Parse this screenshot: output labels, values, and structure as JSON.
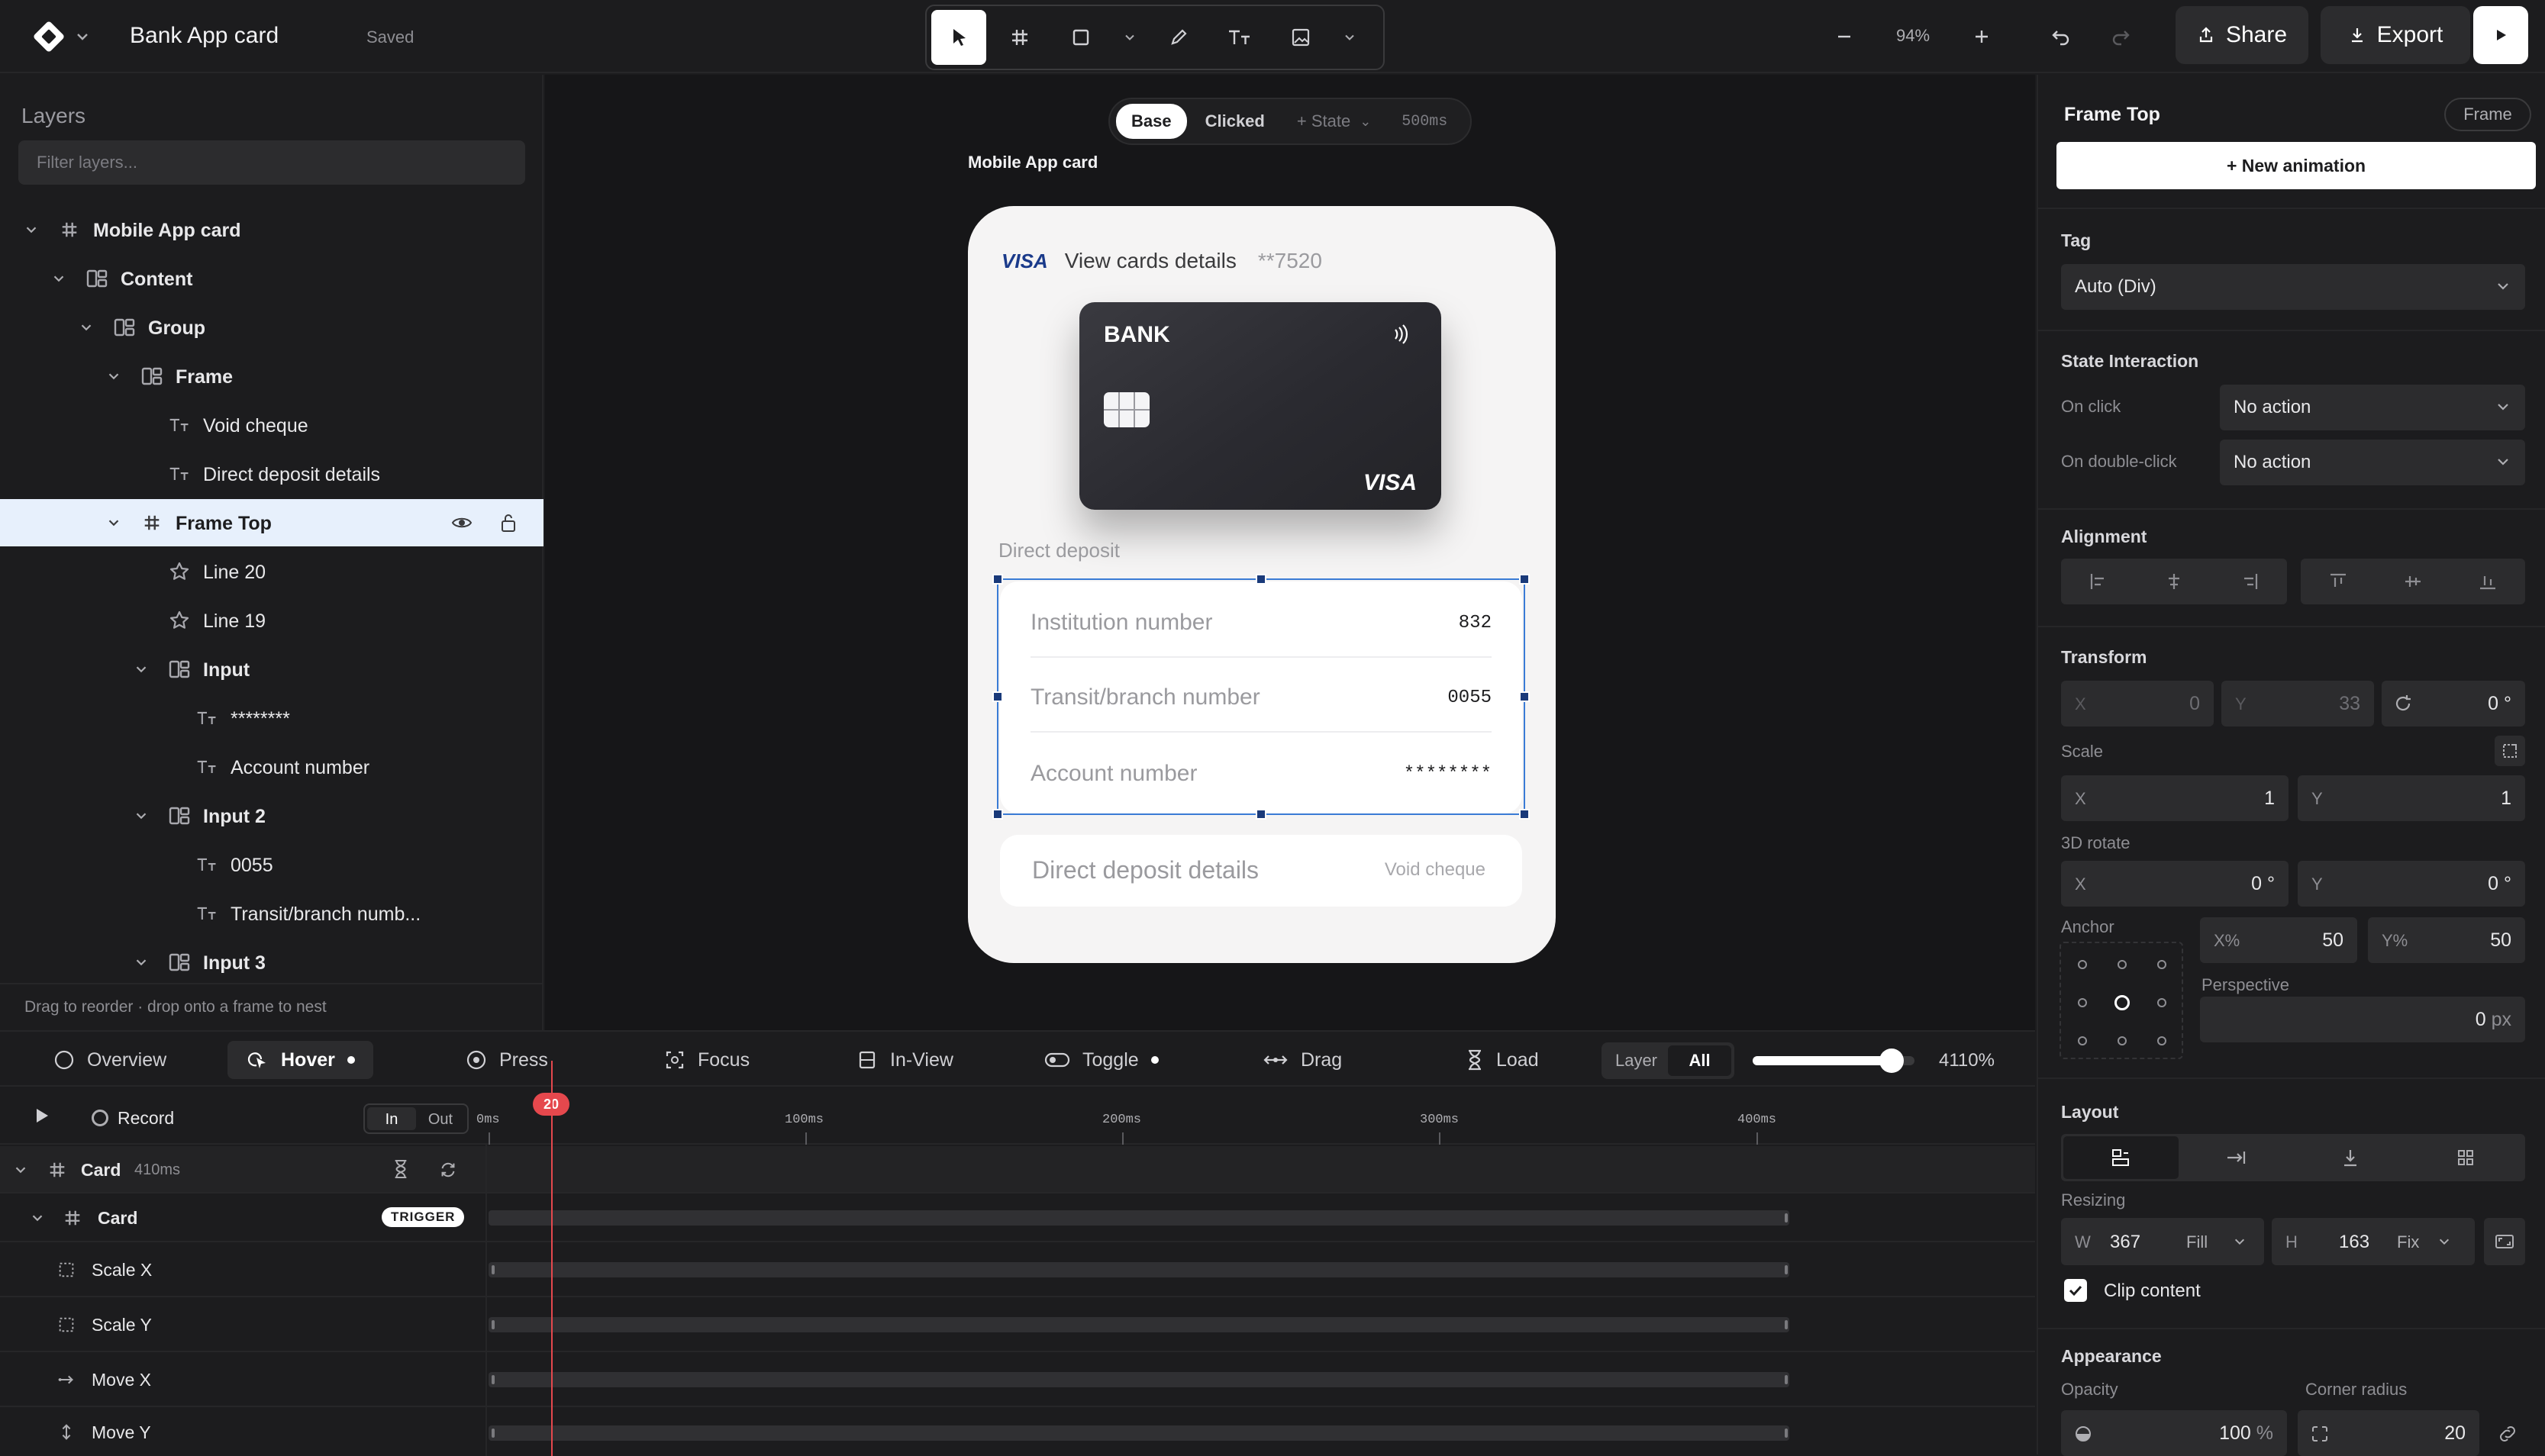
{
  "app": {
    "title": "Bank App card",
    "status": "Saved"
  },
  "toolbar": {
    "tools": [
      "pointer-icon",
      "frame-hash-icon",
      "rectangle-icon",
      "pen-icon",
      "text-icon",
      "image-icon"
    ],
    "zoom": "94%"
  },
  "actions": {
    "share": "Share",
    "export": "Export"
  },
  "layers": {
    "title": "Layers",
    "filter_placeholder": "Filter layers...",
    "items": [
      {
        "label": "Mobile App card",
        "icon": "frame-hash-icon",
        "depth": 0,
        "expanded": true,
        "bold": true
      },
      {
        "label": "Content",
        "icon": "stack-layout-icon",
        "depth": 1,
        "expanded": true,
        "bold": true
      },
      {
        "label": "Group",
        "icon": "stack-layout-icon",
        "depth": 2,
        "expanded": true,
        "bold": true
      },
      {
        "label": "Frame",
        "icon": "stack-layout-icon",
        "depth": 3,
        "expanded": true,
        "bold": true
      },
      {
        "label": "Void cheque",
        "icon": "text-icon",
        "depth": 4,
        "bold": false
      },
      {
        "label": "Direct deposit details",
        "icon": "text-icon",
        "depth": 4,
        "bold": false
      },
      {
        "label": "Frame Top",
        "icon": "frame-hash-icon",
        "depth": 3,
        "expanded": true,
        "bold": true,
        "selected": true
      },
      {
        "label": "Line 20",
        "icon": "star-icon",
        "depth": 4,
        "bold": false
      },
      {
        "label": "Line 19",
        "icon": "star-icon",
        "depth": 4,
        "bold": false
      },
      {
        "label": "Input",
        "icon": "stack-layout-icon",
        "depth": 4,
        "expanded": true,
        "bold": true
      },
      {
        "label": "********",
        "icon": "text-icon",
        "depth": 5,
        "bold": false
      },
      {
        "label": "Account number",
        "icon": "text-icon",
        "depth": 5,
        "bold": false
      },
      {
        "label": "Input 2",
        "icon": "stack-layout-icon",
        "depth": 4,
        "expanded": true,
        "bold": true
      },
      {
        "label": "0055",
        "icon": "text-icon",
        "depth": 5,
        "bold": false
      },
      {
        "label": "Transit/branch numb...",
        "icon": "text-icon",
        "depth": 5,
        "bold": false
      },
      {
        "label": "Input 3",
        "icon": "stack-layout-icon",
        "depth": 4,
        "expanded": true,
        "bold": true
      }
    ],
    "hint": "Drag to reorder · drop onto a frame to nest"
  },
  "canvas": {
    "states": {
      "base": "Base",
      "clicked": "Clicked",
      "add": "+ State",
      "duration": "500ms"
    },
    "frame_name": "Mobile App card",
    "card": {
      "visa_logo": "VISA",
      "view_details": "View cards details",
      "masked_number": "**7520",
      "bank_name": "BANK",
      "card_brand": "VISA",
      "section_label": "Direct deposit",
      "fields": [
        {
          "label": "Institution number",
          "value": "832"
        },
        {
          "label": "Transit/branch number",
          "value": "0055"
        },
        {
          "label": "Account number",
          "value": "********"
        }
      ],
      "details_label": "Direct deposit details",
      "void_cheque": "Void cheque"
    }
  },
  "timeline": {
    "triggers": [
      {
        "label": "Overview",
        "icon": "circle-icon"
      },
      {
        "label": "Hover",
        "icon": "hover-cursor-icon",
        "active": true,
        "dot": true
      },
      {
        "label": "Press",
        "icon": "press-icon"
      },
      {
        "label": "Focus",
        "icon": "focus-icon"
      },
      {
        "label": "In-View",
        "icon": "in-view-icon"
      },
      {
        "label": "Toggle",
        "icon": "toggle-icon",
        "dot": true
      },
      {
        "label": "Drag",
        "icon": "drag-icon"
      },
      {
        "label": "Load",
        "icon": "hourglass-icon"
      }
    ],
    "scope": {
      "layer": "Layer",
      "all": "All"
    },
    "zoom_fraction": 0.86,
    "zoom_label": "4110%",
    "record": "Record",
    "in": "In",
    "out": "Out",
    "ruler": [
      "0ms",
      "100ms",
      "200ms",
      "300ms",
      "400ms"
    ],
    "playhead": "20",
    "tracks": [
      {
        "name": "Card",
        "duration": "410ms",
        "type": "group"
      },
      {
        "name": "Card",
        "badge": "TRIGGER",
        "type": "layer"
      },
      {
        "name": "Scale X",
        "icon": "scale-icon"
      },
      {
        "name": "Scale Y",
        "icon": "scale-icon"
      },
      {
        "name": "Move X",
        "icon": "move-x-icon"
      },
      {
        "name": "Move Y",
        "icon": "move-y-icon"
      }
    ]
  },
  "inspector": {
    "title": "Frame Top",
    "badge": "Frame",
    "new_animation": "+ New animation",
    "tag": {
      "label": "Tag",
      "value": "Auto (Div)"
    },
    "state_interaction": {
      "title": "State Interaction",
      "on_click": {
        "label": "On click",
        "value": "No action"
      },
      "on_double_click": {
        "label": "On double-click",
        "value": "No action"
      }
    },
    "alignment": "Alignment",
    "transform": {
      "title": "Transform",
      "x": {
        "k": "X",
        "v": "0"
      },
      "y": {
        "k": "Y",
        "v": "33"
      },
      "rotate": "0 °",
      "scale_label": "Scale",
      "scale_x": {
        "k": "X",
        "v": "1"
      },
      "scale_y": {
        "k": "Y",
        "v": "1"
      },
      "rotate3d_label": "3D rotate",
      "rot_x": {
        "k": "X",
        "v": "0 °"
      },
      "rot_y": {
        "k": "Y",
        "v": "0 °"
      },
      "anchor_label": "Anchor",
      "anchor_x": {
        "k": "X%",
        "v": "50"
      },
      "anchor_y": {
        "k": "Y%",
        "v": "50"
      },
      "perspective_label": "Perspective",
      "perspective": {
        "v": "0",
        "u": "px"
      }
    },
    "layout": {
      "title": "Layout",
      "resizing": "Resizing",
      "w": {
        "k": "W",
        "v": "367",
        "mode": "Fill"
      },
      "h": {
        "k": "H",
        "v": "163",
        "mode": "Fix"
      },
      "clip": "Clip content"
    },
    "appearance": {
      "title": "Appearance",
      "opacity_label": "Opacity",
      "opacity": {
        "v": "100",
        "u": "%"
      },
      "radius_label": "Corner radius",
      "radius": "20"
    }
  }
}
